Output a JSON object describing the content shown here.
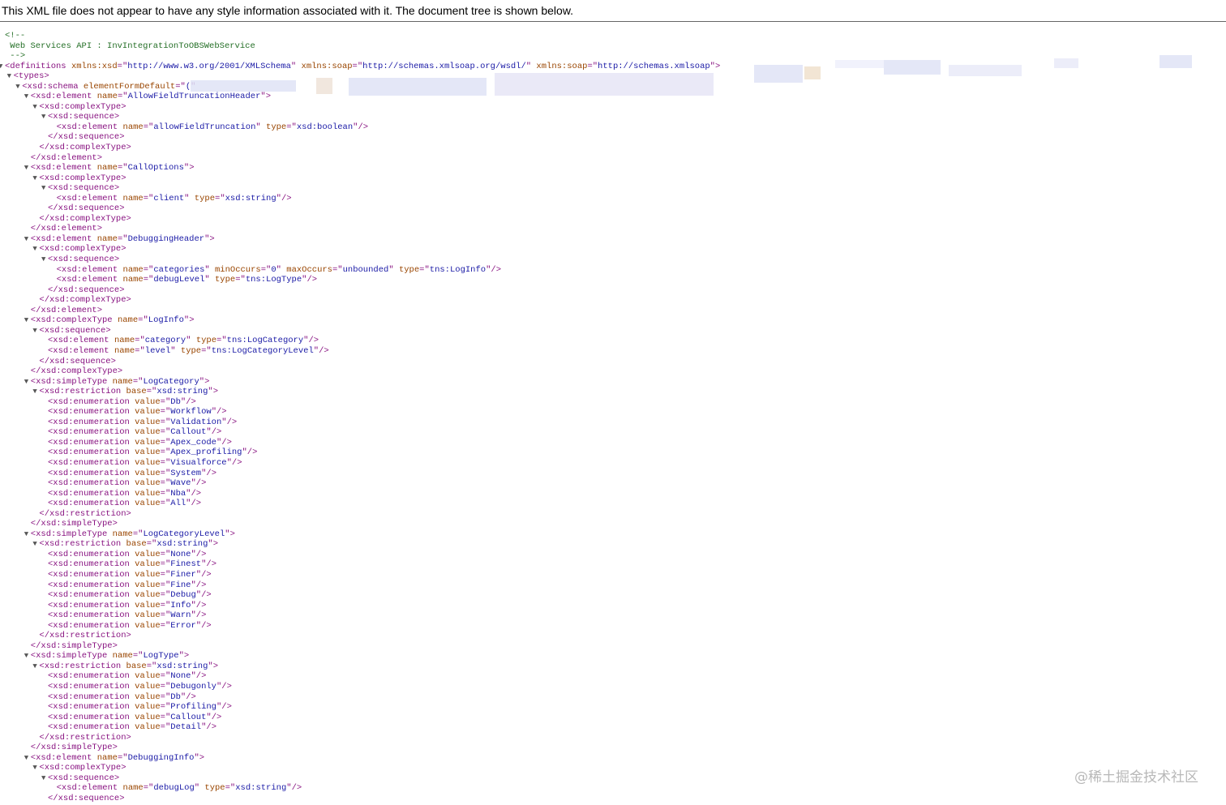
{
  "notice": "This XML file does not appear to have any style information associated with it. The document tree is shown below.",
  "watermark": "@稀土掘金技术社区",
  "lines": [
    {
      "d": 0,
      "t": "comment",
      "text": "<!--"
    },
    {
      "d": 0,
      "t": "comment",
      "text": " Web Services API : InvIntegrationToOBSWebService"
    },
    {
      "d": 0,
      "t": "comment",
      "text": " -->"
    },
    {
      "d": 0,
      "t": "open",
      "arrow": true,
      "name": "definitions",
      "attrs": [
        [
          "xmlns:xsd",
          "http://www.w3.org/2001/XMLSchema"
        ],
        [
          "xmlns:soap",
          "http://schemas.xmlsoap.org/wsdl/"
        ],
        [
          "xmlns:soap",
          "http://schemas.xmlsoap"
        ]
      ]
    },
    {
      "d": 1,
      "t": "open",
      "arrow": true,
      "name": "types",
      "attrs": []
    },
    {
      "d": 2,
      "t": "open",
      "arrow": true,
      "name": "xsd:schema",
      "attrs": [
        [
          "elementFormDefault",
          "("
        ]
      ],
      "unclosed": true
    },
    {
      "d": 3,
      "t": "open",
      "arrow": true,
      "name": "xsd:element",
      "attrs": [
        [
          "name",
          "AllowFieldTruncationHeader"
        ]
      ]
    },
    {
      "d": 4,
      "t": "open",
      "arrow": true,
      "name": "xsd:complexType",
      "attrs": []
    },
    {
      "d": 5,
      "t": "open",
      "arrow": true,
      "name": "xsd:sequence",
      "attrs": []
    },
    {
      "d": 6,
      "t": "self",
      "name": "xsd:element",
      "attrs": [
        [
          "name",
          "allowFieldTruncation"
        ],
        [
          "type",
          "xsd:boolean"
        ]
      ]
    },
    {
      "d": 5,
      "t": "close",
      "name": "xsd:sequence"
    },
    {
      "d": 4,
      "t": "close",
      "name": "xsd:complexType"
    },
    {
      "d": 3,
      "t": "close",
      "name": "xsd:element"
    },
    {
      "d": 3,
      "t": "open",
      "arrow": true,
      "name": "xsd:element",
      "attrs": [
        [
          "name",
          "CallOptions"
        ]
      ]
    },
    {
      "d": 4,
      "t": "open",
      "arrow": true,
      "name": "xsd:complexType",
      "attrs": []
    },
    {
      "d": 5,
      "t": "open",
      "arrow": true,
      "name": "xsd:sequence",
      "attrs": []
    },
    {
      "d": 6,
      "t": "self",
      "name": "xsd:element",
      "attrs": [
        [
          "name",
          "client"
        ],
        [
          "type",
          "xsd:string"
        ]
      ]
    },
    {
      "d": 5,
      "t": "close",
      "name": "xsd:sequence"
    },
    {
      "d": 4,
      "t": "close",
      "name": "xsd:complexType"
    },
    {
      "d": 3,
      "t": "close",
      "name": "xsd:element"
    },
    {
      "d": 3,
      "t": "open",
      "arrow": true,
      "name": "xsd:element",
      "attrs": [
        [
          "name",
          "DebuggingHeader"
        ]
      ]
    },
    {
      "d": 4,
      "t": "open",
      "arrow": true,
      "name": "xsd:complexType",
      "attrs": []
    },
    {
      "d": 5,
      "t": "open",
      "arrow": true,
      "name": "xsd:sequence",
      "attrs": []
    },
    {
      "d": 6,
      "t": "self",
      "name": "xsd:element",
      "attrs": [
        [
          "name",
          "categories"
        ],
        [
          "minOccurs",
          "0"
        ],
        [
          "maxOccurs",
          "unbounded"
        ],
        [
          "type",
          "tns:LogInfo"
        ]
      ]
    },
    {
      "d": 6,
      "t": "self",
      "name": "xsd:element",
      "attrs": [
        [
          "name",
          "debugLevel"
        ],
        [
          "type",
          "tns:LogType"
        ]
      ]
    },
    {
      "d": 5,
      "t": "close",
      "name": "xsd:sequence"
    },
    {
      "d": 4,
      "t": "close",
      "name": "xsd:complexType"
    },
    {
      "d": 3,
      "t": "close",
      "name": "xsd:element"
    },
    {
      "d": 3,
      "t": "open",
      "arrow": true,
      "name": "xsd:complexType",
      "attrs": [
        [
          "name",
          "LogInfo"
        ]
      ]
    },
    {
      "d": 4,
      "t": "open",
      "arrow": true,
      "name": "xsd:sequence",
      "attrs": []
    },
    {
      "d": 5,
      "t": "self",
      "name": "xsd:element",
      "attrs": [
        [
          "name",
          "category"
        ],
        [
          "type",
          "tns:LogCategory"
        ]
      ]
    },
    {
      "d": 5,
      "t": "self",
      "name": "xsd:element",
      "attrs": [
        [
          "name",
          "level"
        ],
        [
          "type",
          "tns:LogCategoryLevel"
        ]
      ]
    },
    {
      "d": 4,
      "t": "close",
      "name": "xsd:sequence"
    },
    {
      "d": 3,
      "t": "close",
      "name": "xsd:complexType"
    },
    {
      "d": 3,
      "t": "open",
      "arrow": true,
      "name": "xsd:simpleType",
      "attrs": [
        [
          "name",
          "LogCategory"
        ]
      ]
    },
    {
      "d": 4,
      "t": "open",
      "arrow": true,
      "name": "xsd:restriction",
      "attrs": [
        [
          "base",
          "xsd:string"
        ]
      ]
    },
    {
      "d": 5,
      "t": "self",
      "name": "xsd:enumeration",
      "attrs": [
        [
          "value",
          "Db"
        ]
      ]
    },
    {
      "d": 5,
      "t": "self",
      "name": "xsd:enumeration",
      "attrs": [
        [
          "value",
          "Workflow"
        ]
      ]
    },
    {
      "d": 5,
      "t": "self",
      "name": "xsd:enumeration",
      "attrs": [
        [
          "value",
          "Validation"
        ]
      ]
    },
    {
      "d": 5,
      "t": "self",
      "name": "xsd:enumeration",
      "attrs": [
        [
          "value",
          "Callout"
        ]
      ]
    },
    {
      "d": 5,
      "t": "self",
      "name": "xsd:enumeration",
      "attrs": [
        [
          "value",
          "Apex_code"
        ]
      ]
    },
    {
      "d": 5,
      "t": "self",
      "name": "xsd:enumeration",
      "attrs": [
        [
          "value",
          "Apex_profiling"
        ]
      ]
    },
    {
      "d": 5,
      "t": "self",
      "name": "xsd:enumeration",
      "attrs": [
        [
          "value",
          "Visualforce"
        ]
      ]
    },
    {
      "d": 5,
      "t": "self",
      "name": "xsd:enumeration",
      "attrs": [
        [
          "value",
          "System"
        ]
      ]
    },
    {
      "d": 5,
      "t": "self",
      "name": "xsd:enumeration",
      "attrs": [
        [
          "value",
          "Wave"
        ]
      ]
    },
    {
      "d": 5,
      "t": "self",
      "name": "xsd:enumeration",
      "attrs": [
        [
          "value",
          "Nba"
        ]
      ]
    },
    {
      "d": 5,
      "t": "self",
      "name": "xsd:enumeration",
      "attrs": [
        [
          "value",
          "All"
        ]
      ]
    },
    {
      "d": 4,
      "t": "close",
      "name": "xsd:restriction"
    },
    {
      "d": 3,
      "t": "close",
      "name": "xsd:simpleType"
    },
    {
      "d": 3,
      "t": "open",
      "arrow": true,
      "name": "xsd:simpleType",
      "attrs": [
        [
          "name",
          "LogCategoryLevel"
        ]
      ]
    },
    {
      "d": 4,
      "t": "open",
      "arrow": true,
      "name": "xsd:restriction",
      "attrs": [
        [
          "base",
          "xsd:string"
        ]
      ]
    },
    {
      "d": 5,
      "t": "self",
      "name": "xsd:enumeration",
      "attrs": [
        [
          "value",
          "None"
        ]
      ]
    },
    {
      "d": 5,
      "t": "self",
      "name": "xsd:enumeration",
      "attrs": [
        [
          "value",
          "Finest"
        ]
      ]
    },
    {
      "d": 5,
      "t": "self",
      "name": "xsd:enumeration",
      "attrs": [
        [
          "value",
          "Finer"
        ]
      ]
    },
    {
      "d": 5,
      "t": "self",
      "name": "xsd:enumeration",
      "attrs": [
        [
          "value",
          "Fine"
        ]
      ]
    },
    {
      "d": 5,
      "t": "self",
      "name": "xsd:enumeration",
      "attrs": [
        [
          "value",
          "Debug"
        ]
      ]
    },
    {
      "d": 5,
      "t": "self",
      "name": "xsd:enumeration",
      "attrs": [
        [
          "value",
          "Info"
        ]
      ]
    },
    {
      "d": 5,
      "t": "self",
      "name": "xsd:enumeration",
      "attrs": [
        [
          "value",
          "Warn"
        ]
      ]
    },
    {
      "d": 5,
      "t": "self",
      "name": "xsd:enumeration",
      "attrs": [
        [
          "value",
          "Error"
        ]
      ]
    },
    {
      "d": 4,
      "t": "close",
      "name": "xsd:restriction"
    },
    {
      "d": 3,
      "t": "close",
      "name": "xsd:simpleType"
    },
    {
      "d": 3,
      "t": "open",
      "arrow": true,
      "name": "xsd:simpleType",
      "attrs": [
        [
          "name",
          "LogType"
        ]
      ]
    },
    {
      "d": 4,
      "t": "open",
      "arrow": true,
      "name": "xsd:restriction",
      "attrs": [
        [
          "base",
          "xsd:string"
        ]
      ]
    },
    {
      "d": 5,
      "t": "self",
      "name": "xsd:enumeration",
      "attrs": [
        [
          "value",
          "None"
        ]
      ]
    },
    {
      "d": 5,
      "t": "self",
      "name": "xsd:enumeration",
      "attrs": [
        [
          "value",
          "Debugonly"
        ]
      ]
    },
    {
      "d": 5,
      "t": "self",
      "name": "xsd:enumeration",
      "attrs": [
        [
          "value",
          "Db"
        ]
      ]
    },
    {
      "d": 5,
      "t": "self",
      "name": "xsd:enumeration",
      "attrs": [
        [
          "value",
          "Profiling"
        ]
      ]
    },
    {
      "d": 5,
      "t": "self",
      "name": "xsd:enumeration",
      "attrs": [
        [
          "value",
          "Callout"
        ]
      ]
    },
    {
      "d": 5,
      "t": "self",
      "name": "xsd:enumeration",
      "attrs": [
        [
          "value",
          "Detail"
        ]
      ]
    },
    {
      "d": 4,
      "t": "close",
      "name": "xsd:restriction"
    },
    {
      "d": 3,
      "t": "close",
      "name": "xsd:simpleType"
    },
    {
      "d": 3,
      "t": "open",
      "arrow": true,
      "name": "xsd:element",
      "attrs": [
        [
          "name",
          "DebuggingInfo"
        ]
      ]
    },
    {
      "d": 4,
      "t": "open",
      "arrow": true,
      "name": "xsd:complexType",
      "attrs": []
    },
    {
      "d": 5,
      "t": "open",
      "arrow": true,
      "name": "xsd:sequence",
      "attrs": []
    },
    {
      "d": 6,
      "t": "self",
      "name": "xsd:element",
      "attrs": [
        [
          "name",
          "debugLog"
        ],
        [
          "type",
          "xsd:string"
        ]
      ]
    },
    {
      "d": 5,
      "t": "close",
      "name": "xsd:sequence"
    }
  ]
}
